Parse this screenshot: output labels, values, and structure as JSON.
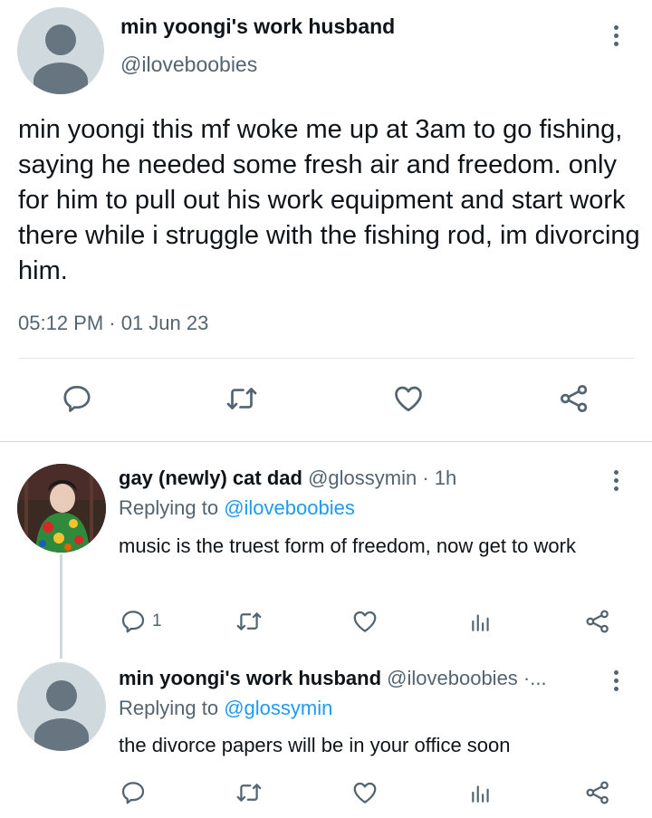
{
  "main_tweet": {
    "display_name": "min yoongi's work husband",
    "handle": "@iloveboobies",
    "text": "min yoongi this mf woke me up at 3am to go fishing, saying he needed some fresh air and freedom. only for him to pull out his work equipment and start work there while i struggle with the fishing rod, im divorcing him.",
    "timestamp": "05:12 PM · 01 Jun 23",
    "actions": [
      "reply-icon",
      "retweet-icon",
      "like-icon",
      "share-icon"
    ]
  },
  "replies": [
    {
      "display_name": "gay (newly) cat dad",
      "handle": "@glossymin",
      "time": " · 1h",
      "replying_prefix": "Replying to ",
      "replying_to": "@iloveboobies",
      "text": "music is the truest form of freedom, now get to work",
      "reply_count": "1"
    },
    {
      "display_name": "min yoongi's work husband",
      "handle": "@iloveboobies",
      "time": " ·...",
      "replying_prefix": "Replying to ",
      "replying_to": "@glossymin",
      "text": "the divorce papers will be in your office soon",
      "reply_count": ""
    }
  ],
  "colors": {
    "text": "#0f1419",
    "secondary": "#536471",
    "link": "#1d9bf0",
    "avatar_bg": "#cfd9de",
    "avatar_fg": "#66757f"
  }
}
